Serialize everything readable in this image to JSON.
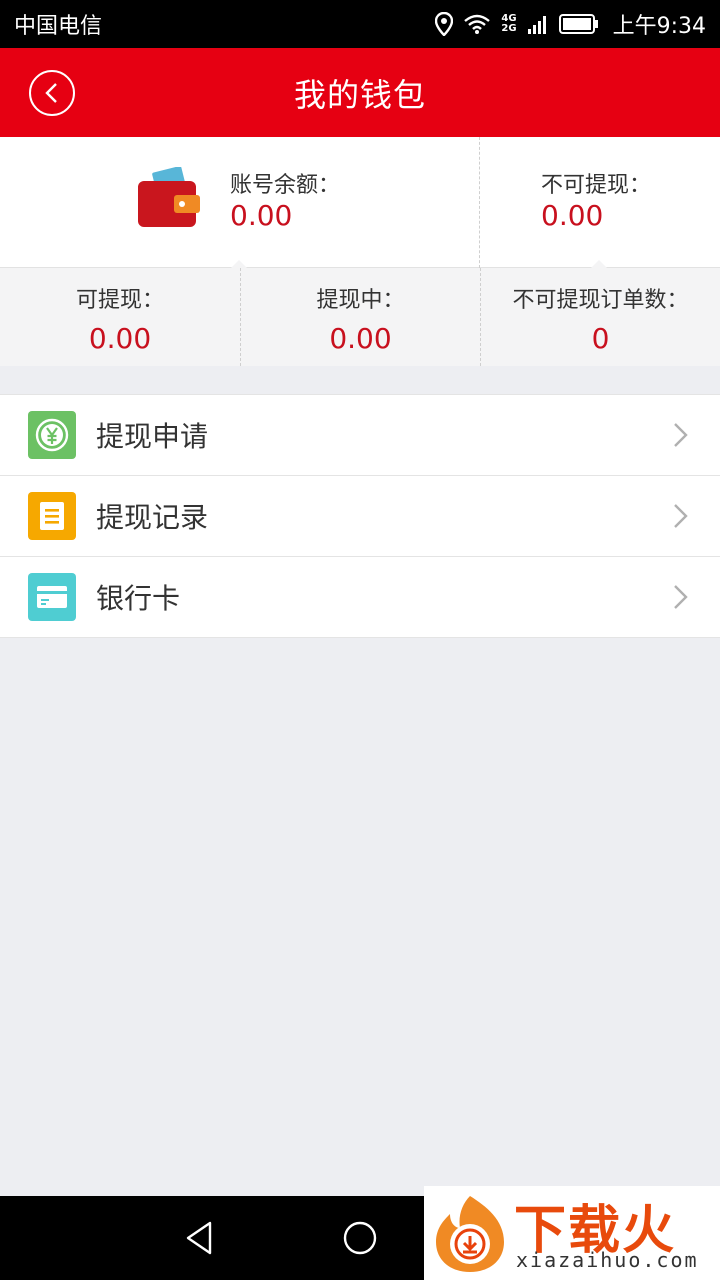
{
  "status_bar": {
    "carrier": "中国电信",
    "net_top": "4G",
    "net_bottom": "2G",
    "time": "上午9:34"
  },
  "header": {
    "title": "我的钱包"
  },
  "balance": {
    "account_label": "账号余额：",
    "account_value": "0.00",
    "non_withdrawable_label": "不可提现：",
    "non_withdrawable_value": "0.00",
    "cells": [
      {
        "label": "可提现：",
        "value": "0.00"
      },
      {
        "label": "提现中：",
        "value": "0.00"
      },
      {
        "label": "不可提现订单数：",
        "value": "0"
      }
    ]
  },
  "menu": {
    "items": [
      {
        "label": "提现申请",
        "icon": "yen-coin-icon",
        "color": "#6cc164"
      },
      {
        "label": "提现记录",
        "icon": "document-icon",
        "color": "#f6a800"
      },
      {
        "label": "银行卡",
        "icon": "bank-card-icon",
        "color": "#4fcdd2"
      }
    ]
  },
  "watermark": {
    "title": "下载火",
    "url": "xiazaihuo.com"
  },
  "colors": {
    "header": "#e60012",
    "value_red": "#c8101e"
  }
}
